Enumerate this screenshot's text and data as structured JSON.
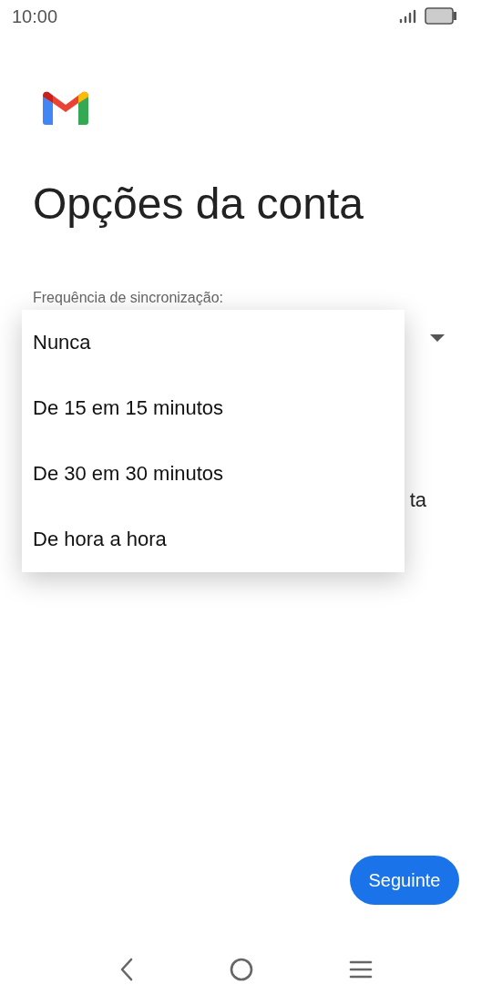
{
  "status_bar": {
    "time": "10:00"
  },
  "title": "Opções da conta",
  "sync_field": {
    "label": "Frequência de sincronização:"
  },
  "hidden_text": "ta",
  "menu": {
    "items": [
      {
        "label": "Nunca"
      },
      {
        "label": "De 15 em 15 minutos"
      },
      {
        "label": "De 30 em 30 minutos"
      },
      {
        "label": "De hora a hora"
      }
    ]
  },
  "next_button": "Seguinte"
}
